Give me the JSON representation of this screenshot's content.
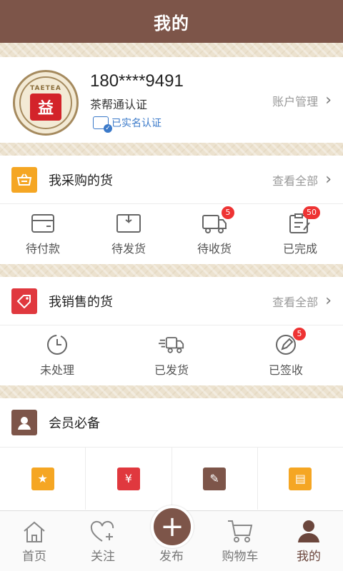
{
  "header": {
    "title": "我的"
  },
  "profile": {
    "logo_text": "TAETEA",
    "logo_char": "益",
    "phone": "180****9491",
    "verify_text": "茶帮通认证",
    "realname_text": "已实名认证",
    "account_label": "账户管理"
  },
  "purchases": {
    "title": "我采购的货",
    "more": "查看全部",
    "items": [
      {
        "label": "待付款",
        "icon": "wallet-icon"
      },
      {
        "label": "待发货",
        "icon": "box-icon"
      },
      {
        "label": "待收货",
        "icon": "truck-icon",
        "badge": "5"
      },
      {
        "label": "已完成",
        "icon": "clipboard-check-icon",
        "badge": "50"
      }
    ]
  },
  "sales": {
    "title": "我销售的货",
    "more": "查看全部",
    "items": [
      {
        "label": "未处理",
        "icon": "clock-icon"
      },
      {
        "label": "已发货",
        "icon": "delivery-truck-icon"
      },
      {
        "label": "已签收",
        "icon": "pen-circle-icon",
        "badge": "5"
      }
    ]
  },
  "members": {
    "title": "会员必备",
    "cells": [
      {
        "icon": "star-icon",
        "color": "#f5a623"
      },
      {
        "icon": "yen-icon",
        "color": "#e0383e"
      },
      {
        "icon": "edit-icon",
        "color": "#7d5549"
      },
      {
        "icon": "wallet-card-icon",
        "color": "#f5a623"
      }
    ]
  },
  "tabbar": {
    "tabs": [
      {
        "label": "首页",
        "icon": "home-icon"
      },
      {
        "label": "关注",
        "icon": "heart-plus-icon"
      },
      {
        "label": "发布",
        "icon": "plus-icon"
      },
      {
        "label": "购物车",
        "icon": "cart-icon"
      },
      {
        "label": "我的",
        "icon": "user-icon",
        "active": true
      }
    ]
  },
  "colors": {
    "brand": "#7d5549",
    "accent_orange": "#f5a623",
    "accent_red": "#e0383e",
    "link_blue": "#3a79c9",
    "badge": "#e33333"
  }
}
